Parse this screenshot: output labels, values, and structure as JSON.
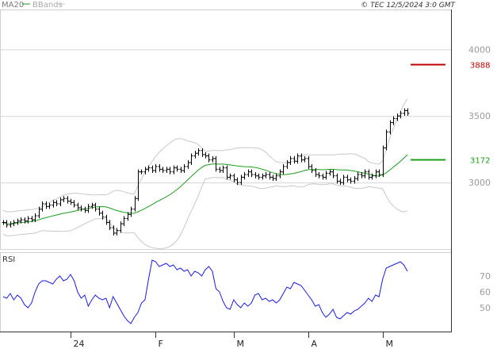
{
  "header": {
    "ma_label": "MA20",
    "bbands_label": "BBands",
    "copyright": "© TEC 12/5/2024 3:0 GMT"
  },
  "rsi_label": "RSI",
  "chart_data": [
    {
      "type": "candlestick",
      "title": "",
      "ylim": [
        2500,
        4300
      ],
      "y_ticks": [
        3000,
        3500,
        4000
      ],
      "x_ticks": [
        "24",
        "F",
        "M",
        "A",
        "M"
      ],
      "bollinger_periods": 20,
      "markers": [
        {
          "label": "3888",
          "value": 3888,
          "color": "#c00000"
        },
        {
          "label": "3172",
          "value": 3172,
          "color": "#1aa01a"
        }
      ],
      "close": [
        2700,
        2680,
        2690,
        2700,
        2710,
        2720,
        2710,
        2730,
        2720,
        2750,
        2800,
        2840,
        2820,
        2830,
        2850,
        2840,
        2870,
        2880,
        2860,
        2850,
        2830,
        2810,
        2800,
        2790,
        2820,
        2830,
        2800,
        2770,
        2740,
        2700,
        2660,
        2620,
        2640,
        2690,
        2730,
        2760,
        2800,
        2880,
        3080,
        3080,
        3100,
        3110,
        3090,
        3120,
        3100,
        3090,
        3100,
        3080,
        3110,
        3100,
        3090,
        3120,
        3150,
        3200,
        3220,
        3240,
        3210,
        3200,
        3170,
        3180,
        3100,
        3090,
        3110,
        3040,
        3050,
        3020,
        3000,
        3040,
        3060,
        3080,
        3060,
        3050,
        3040,
        3050,
        3060,
        3040,
        3030,
        3050,
        3080,
        3120,
        3150,
        3180,
        3160,
        3200,
        3170,
        3180,
        3120,
        3090,
        3060,
        3050,
        3040,
        3070,
        3080,
        3050,
        3010,
        3000,
        3040,
        3020,
        3010,
        3030,
        3060,
        3050,
        3080,
        3040,
        3050,
        3080,
        3060,
        3260,
        3380,
        3450,
        3480,
        3500,
        3520,
        3540,
        3520
      ],
      "rsi": {
        "ylim": [
          35,
          85
        ],
        "y_ticks": [
          50,
          60,
          70
        ],
        "values": [
          57,
          56,
          59,
          55,
          58,
          56,
          52,
          50,
          53,
          60,
          65,
          67,
          67,
          66,
          65,
          68,
          70,
          67,
          68,
          71,
          67,
          60,
          56,
          58,
          51,
          55,
          58,
          56,
          55,
          56,
          50,
          57,
          53,
          49,
          45,
          42,
          40,
          44,
          47,
          53,
          55,
          68,
          80,
          79,
          76,
          77,
          78,
          76,
          77,
          74,
          75,
          73,
          74,
          70,
          73,
          72,
          70,
          74,
          76,
          73,
          62,
          60,
          54,
          50,
          49,
          55,
          52,
          50,
          53,
          51,
          53,
          58,
          59,
          55,
          56,
          54,
          55,
          53,
          55,
          59,
          63,
          62,
          66,
          65,
          64,
          61,
          58,
          55,
          51,
          52,
          47,
          44,
          46,
          49,
          44,
          43,
          45,
          47,
          46,
          48,
          49,
          51,
          53,
          56,
          54,
          58,
          57,
          68,
          75,
          76,
          77,
          78,
          79,
          77,
          73
        ]
      }
    }
  ]
}
